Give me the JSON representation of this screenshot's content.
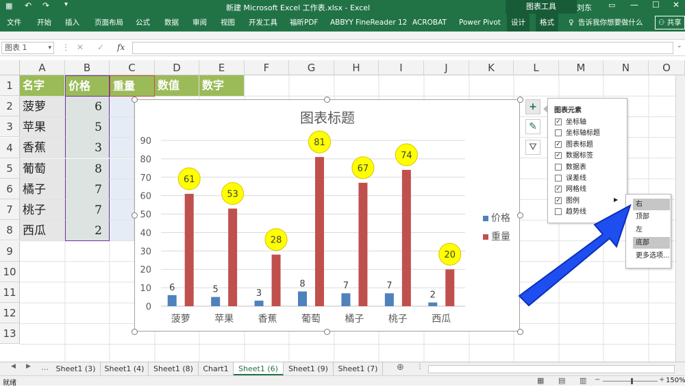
{
  "titlebar": {
    "title": "新建 Microsoft Excel 工作表.xlsx  -  Excel",
    "context_tools": "图表工具",
    "user": "刘东"
  },
  "ribbon": {
    "tabs": [
      "文件",
      "开始",
      "插入",
      "页面布局",
      "公式",
      "数据",
      "审阅",
      "视图",
      "开发工具",
      "福昕PDF",
      "ABBYY FineReader 12",
      "ACROBAT",
      "Power Pivot",
      "设计",
      "格式"
    ],
    "tell_me": "告诉我你想要做什么",
    "share": "共享"
  },
  "formula_bar": {
    "name_box": "图表 1",
    "fx": "fx",
    "formula": ""
  },
  "grid": {
    "columns": [
      "A",
      "B",
      "C",
      "D",
      "E",
      "F",
      "G",
      "H",
      "I",
      "J",
      "K",
      "L",
      "M",
      "N",
      "O"
    ],
    "rows": [
      "1",
      "2",
      "3",
      "4",
      "5",
      "6",
      "7",
      "8",
      "9",
      "10",
      "11",
      "12",
      "13"
    ],
    "headers": [
      "名字",
      "价格",
      "重量",
      "数值",
      "数字"
    ],
    "data_rows": [
      {
        "name": "菠萝",
        "price": "6"
      },
      {
        "name": "苹果",
        "price": "5"
      },
      {
        "name": "香蕉",
        "price": "3"
      },
      {
        "name": "葡萄",
        "price": "8"
      },
      {
        "name": "橘子",
        "price": "7"
      },
      {
        "name": "桃子",
        "price": "7"
      },
      {
        "name": "西瓜",
        "price": "2"
      }
    ]
  },
  "chart_data": {
    "type": "bar",
    "title": "图表标题",
    "categories": [
      "菠萝",
      "苹果",
      "香蕉",
      "葡萄",
      "橘子",
      "桃子",
      "西瓜"
    ],
    "series": [
      {
        "name": "价格",
        "values": [
          6,
          5,
          3,
          8,
          7,
          7,
          2
        ],
        "color": "#4f81bd"
      },
      {
        "name": "重量",
        "values": [
          61,
          53,
          28,
          81,
          67,
          74,
          20
        ],
        "color": "#c0504d"
      }
    ],
    "ylim": [
      0,
      90
    ],
    "yticks": [
      "0",
      "10",
      "20",
      "30",
      "40",
      "50",
      "60",
      "70",
      "80",
      "90"
    ],
    "grid": true,
    "legend": "right",
    "label_highlight_color": "#ffff00"
  },
  "chart_elements_panel": {
    "title": "图表元素",
    "items": [
      {
        "label": "坐标轴",
        "checked": true
      },
      {
        "label": "坐标轴标题",
        "checked": false
      },
      {
        "label": "图表标题",
        "checked": true
      },
      {
        "label": "数据标签",
        "checked": true
      },
      {
        "label": "数据表",
        "checked": false
      },
      {
        "label": "误差线",
        "checked": false
      },
      {
        "label": "网格线",
        "checked": true
      },
      {
        "label": "图例",
        "checked": true
      },
      {
        "label": "趋势线",
        "checked": false
      }
    ]
  },
  "legend_submenu": {
    "items": [
      "右",
      "顶部",
      "左",
      "底部",
      "更多选项..."
    ]
  },
  "sheet_tabs": [
    "Sheet1 (3)",
    "Sheet1 (4)",
    "Sheet1 (8)",
    "Chart1",
    "Sheet1 (6)",
    "Sheet1 (9)",
    "Sheet1 (7)"
  ],
  "active_sheet_index": 4,
  "status": {
    "ready": "就绪",
    "zoom": "150%"
  },
  "colors": {
    "excel_green": "#217346",
    "header_fill": "#9bbb59",
    "arrow_blue": "#1f4ef0"
  }
}
